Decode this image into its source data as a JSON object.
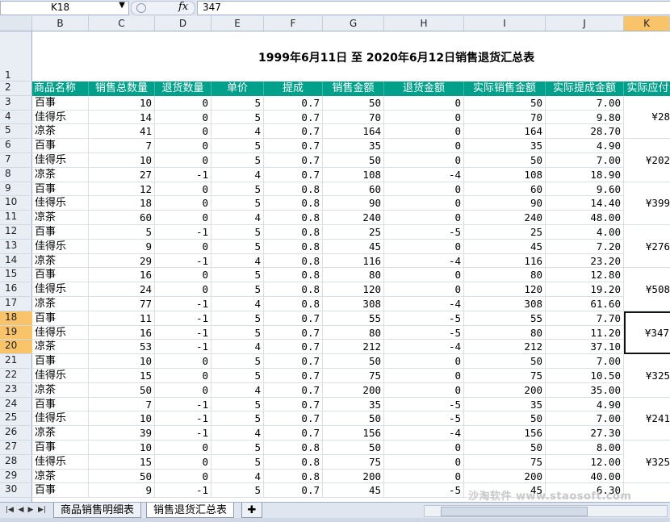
{
  "formula_bar": {
    "name_box": "K18",
    "formula": "347",
    "fx_label": "fx"
  },
  "columns": [
    "B",
    "C",
    "D",
    "E",
    "F",
    "G",
    "H",
    "I",
    "J",
    "K"
  ],
  "rows": [
    1,
    2,
    3,
    4,
    5,
    6,
    7,
    8,
    9,
    10,
    11,
    12,
    13,
    14,
    15,
    16,
    17,
    18,
    19,
    20,
    21,
    22,
    23,
    24,
    25,
    26,
    27,
    28,
    29,
    30
  ],
  "title": "1999年6月11日 至 2020年6月12日销售退货汇总表",
  "headers": [
    "商品名称",
    "销售总数量",
    "退货数量",
    "单价",
    "提成",
    "销售金额",
    "退货金额",
    "实际销售金额",
    "实际提成金额",
    "实际应付"
  ],
  "data_rows": [
    [
      "百事",
      "10",
      "0",
      "5",
      "0.7",
      "50",
      "0",
      "50",
      "7.00"
    ],
    [
      "佳得乐",
      "14",
      "0",
      "5",
      "0.7",
      "70",
      "0",
      "70",
      "9.80"
    ],
    [
      "凉茶",
      "41",
      "0",
      "4",
      "0.7",
      "164",
      "0",
      "164",
      "28.70"
    ],
    [
      "百事",
      "7",
      "0",
      "5",
      "0.7",
      "35",
      "0",
      "35",
      "4.90"
    ],
    [
      "佳得乐",
      "10",
      "0",
      "5",
      "0.7",
      "50",
      "0",
      "50",
      "7.00"
    ],
    [
      "凉茶",
      "27",
      "-1",
      "4",
      "0.7",
      "108",
      "-4",
      "108",
      "18.90"
    ],
    [
      "百事",
      "12",
      "0",
      "5",
      "0.8",
      "60",
      "0",
      "60",
      "9.60"
    ],
    [
      "佳得乐",
      "18",
      "0",
      "5",
      "0.8",
      "90",
      "0",
      "90",
      "14.40"
    ],
    [
      "凉茶",
      "60",
      "0",
      "4",
      "0.8",
      "240",
      "0",
      "240",
      "48.00"
    ],
    [
      "百事",
      "5",
      "-1",
      "5",
      "0.8",
      "25",
      "-5",
      "25",
      "4.00"
    ],
    [
      "佳得乐",
      "9",
      "0",
      "5",
      "0.8",
      "45",
      "0",
      "45",
      "7.20"
    ],
    [
      "凉茶",
      "29",
      "-1",
      "4",
      "0.8",
      "116",
      "-4",
      "116",
      "23.20"
    ],
    [
      "百事",
      "16",
      "0",
      "5",
      "0.8",
      "80",
      "0",
      "80",
      "12.80"
    ],
    [
      "佳得乐",
      "24",
      "0",
      "5",
      "0.8",
      "120",
      "0",
      "120",
      "19.20"
    ],
    [
      "凉茶",
      "77",
      "-1",
      "4",
      "0.8",
      "308",
      "-4",
      "308",
      "61.60"
    ],
    [
      "百事",
      "11",
      "-1",
      "5",
      "0.7",
      "55",
      "-5",
      "55",
      "7.70"
    ],
    [
      "佳得乐",
      "16",
      "-1",
      "5",
      "0.7",
      "80",
      "-5",
      "80",
      "11.20"
    ],
    [
      "凉茶",
      "53",
      "-1",
      "4",
      "0.7",
      "212",
      "-4",
      "212",
      "37.10"
    ],
    [
      "百事",
      "10",
      "0",
      "5",
      "0.7",
      "50",
      "0",
      "50",
      "7.00"
    ],
    [
      "佳得乐",
      "15",
      "0",
      "5",
      "0.7",
      "75",
      "0",
      "75",
      "10.50"
    ],
    [
      "凉茶",
      "50",
      "0",
      "4",
      "0.7",
      "200",
      "0",
      "200",
      "35.00"
    ],
    [
      "百事",
      "7",
      "-1",
      "5",
      "0.7",
      "35",
      "-5",
      "35",
      "4.90"
    ],
    [
      "佳得乐",
      "10",
      "-1",
      "5",
      "0.7",
      "50",
      "-5",
      "50",
      "7.00"
    ],
    [
      "凉茶",
      "39",
      "-1",
      "4",
      "0.7",
      "156",
      "-4",
      "156",
      "27.30"
    ],
    [
      "百事",
      "10",
      "0",
      "5",
      "0.8",
      "50",
      "0",
      "50",
      "8.00"
    ],
    [
      "佳得乐",
      "15",
      "0",
      "5",
      "0.8",
      "75",
      "0",
      "75",
      "12.00"
    ],
    [
      "凉茶",
      "50",
      "0",
      "4",
      "0.8",
      "200",
      "0",
      "200",
      "40.00"
    ],
    [
      "百事",
      "9",
      "-1",
      "5",
      "0.7",
      "45",
      "-5",
      "45",
      "6.30"
    ]
  ],
  "k_values": [
    "¥28",
    "¥202",
    "¥399",
    "¥276",
    "¥508",
    "¥347",
    "¥325",
    "¥241",
    "¥325"
  ],
  "sheet_tabs": [
    "商品销售明细表",
    "销售退货汇总表"
  ],
  "watermark": "沙淘软件 www.staosoft.com"
}
